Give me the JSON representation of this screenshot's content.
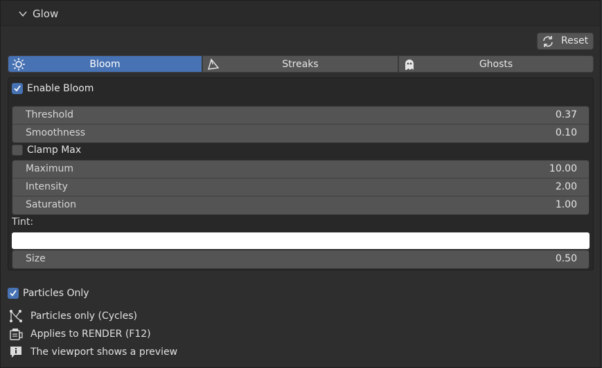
{
  "panel": {
    "title": "Glow"
  },
  "toolbar": {
    "reset_label": "Reset"
  },
  "tabs": [
    {
      "label": "Bloom",
      "icon": "sun-icon",
      "active": true
    },
    {
      "label": "Streaks",
      "icon": "streaks-icon",
      "active": false
    },
    {
      "label": "Ghosts",
      "icon": "ghost-icon",
      "active": false
    }
  ],
  "bloom": {
    "enable": {
      "label": "Enable Bloom",
      "checked": true
    },
    "threshold": {
      "label": "Threshold",
      "value": "0.37"
    },
    "smoothness": {
      "label": "Smoothness",
      "value": "0.10"
    },
    "clamp_max": {
      "label": "Clamp Max",
      "checked": false
    },
    "maximum": {
      "label": "Maximum",
      "value": "10.00"
    },
    "intensity": {
      "label": "Intensity",
      "value": "2.00"
    },
    "saturation": {
      "label": "Saturation",
      "value": "1.00"
    },
    "tint": {
      "label": "Tint:",
      "color": "#ffffff"
    },
    "size": {
      "label": "Size",
      "value": "0.50"
    }
  },
  "particles_only": {
    "label": "Particles Only",
    "checked": true
  },
  "info": [
    {
      "icon": "particles-icon",
      "text": "Particles only (Cycles)"
    },
    {
      "icon": "render-icon",
      "text": "Applies to RENDER (F12)"
    },
    {
      "icon": "info-icon",
      "text": "The viewport shows a preview"
    }
  ],
  "colors": {
    "accent": "#4772b3",
    "field": "#545454",
    "panel": "#2e2e2e"
  }
}
